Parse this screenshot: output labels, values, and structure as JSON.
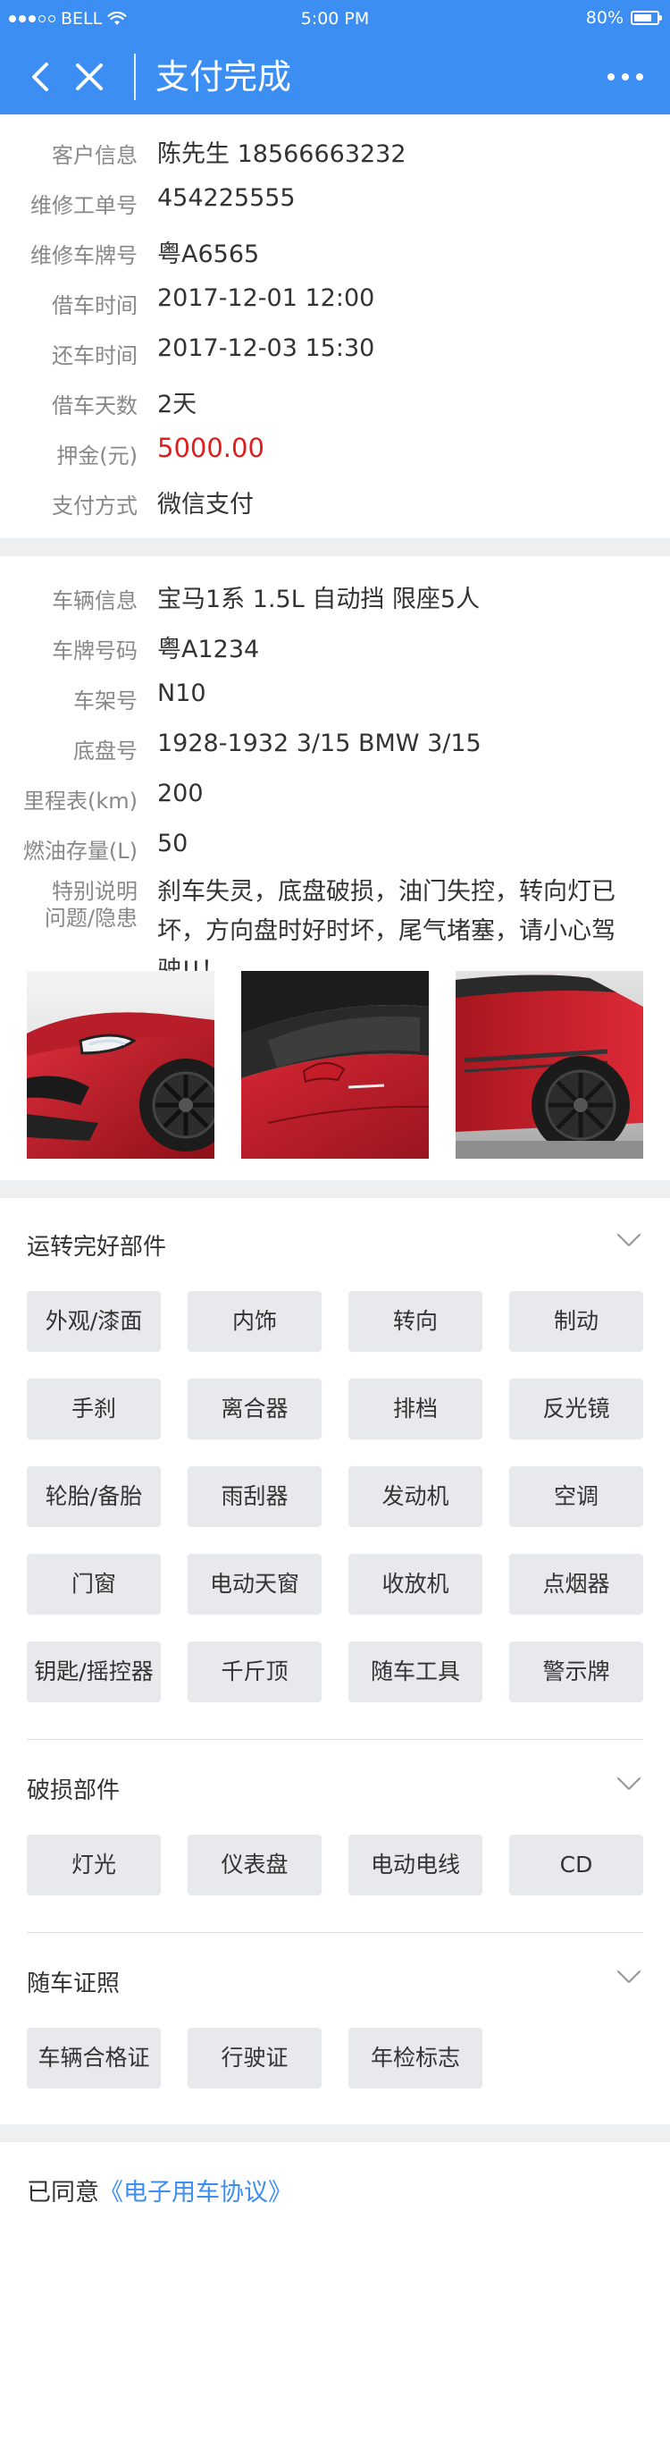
{
  "status_bar": {
    "carrier": "BELL",
    "time": "5:00 PM",
    "battery": "80%",
    "battery_level": 0.8
  },
  "nav": {
    "title": "支付完成"
  },
  "customer": [
    {
      "label": "客户信息",
      "value": "陈先生  18566663232"
    },
    {
      "label": "维修工单号",
      "value": "454225555"
    },
    {
      "label": "维修车牌号",
      "value": "粤A6565"
    },
    {
      "label": "借车时间",
      "value": "2017-12-01 12:00"
    },
    {
      "label": "还车时间",
      "value": "2017-12-03 15:30"
    },
    {
      "label": "借车天数",
      "value": "2天"
    },
    {
      "label": "押金(元)",
      "value": "5000.00"
    },
    {
      "label": "支付方式",
      "value": "微信支付"
    }
  ],
  "vehicle": [
    {
      "label": "车辆信息",
      "value": "宝马1系  1.5L  自动挡  限座5人"
    },
    {
      "label": "车牌号码",
      "value": "粤A1234"
    },
    {
      "label": "车架号",
      "value": "N10"
    },
    {
      "label": "底盘号",
      "value": "1928-1932 3/15 BMW 3/15"
    },
    {
      "label": "里程表(km)",
      "value": "200"
    },
    {
      "label": "燃油存量(L)",
      "value": "50"
    }
  ],
  "remark": {
    "label_line1": "特别说明",
    "label_line2": "问题/隐患",
    "value": "刹车失灵，底盘破损，油门失控，转向灯已坏，方向盘时好时坏，尾气堵塞，请小心驾驶!!！"
  },
  "colors": {
    "accent": "#3d8ef2",
    "deposit": "#e01e1e",
    "chip_bg": "#e7e9ec"
  },
  "sections": {
    "working": {
      "title": "运转完好部件",
      "items": [
        "外观/漆面",
        "内饰",
        "转向",
        "制动",
        "手刹",
        "离合器",
        "排档",
        "反光镜",
        "轮胎/备胎",
        "雨刮器",
        "发动机",
        "空调",
        "门窗",
        "电动天窗",
        "收放机",
        "点烟器",
        "钥匙/摇控器",
        "千斤顶",
        "随车工具",
        "警示牌"
      ]
    },
    "damaged": {
      "title": "破损部件",
      "items": [
        "灯光",
        "仪表盘",
        "电动电线",
        "CD"
      ]
    },
    "documents": {
      "title": "随车证照",
      "items": [
        "车辆合格证",
        "行驶证",
        "年检标志"
      ]
    }
  },
  "agreement": {
    "prefix": "已同意",
    "link": "《电子用车协议》"
  }
}
